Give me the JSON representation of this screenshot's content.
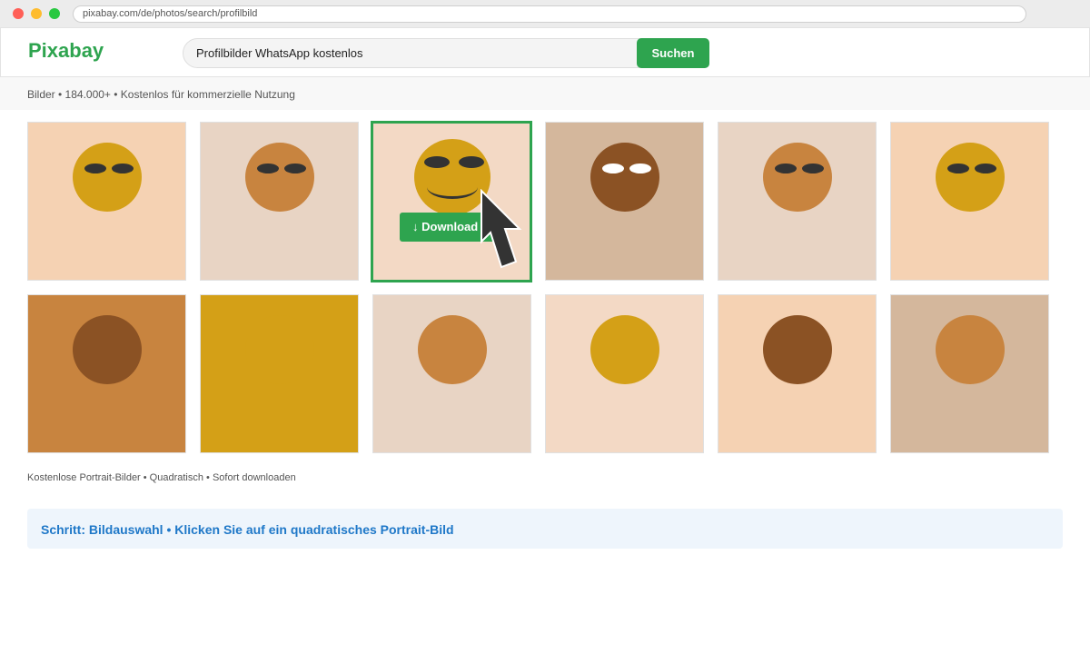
{
  "browser": {
    "url": "pixabay.com/de/photos/search/profilbild"
  },
  "header": {
    "logo": "Pixabay",
    "search_value": "Profilbilder WhatsApp kostenlos",
    "search_button": "Suchen"
  },
  "subbar": {
    "text": "Bilder • 184.000+ • Kostenlos für kommerzielle Nutzung"
  },
  "grid": {
    "row1": [
      {
        "bg": "#f5d2b3",
        "face": "#d4a017",
        "eyes": "dark"
      },
      {
        "bg": "#e8d4c4",
        "face": "#c8843f",
        "eyes": "dark"
      },
      {
        "bg": "#f3d9c5",
        "face": "#d4a017",
        "eyes": "dark",
        "selected": true
      },
      {
        "bg": "#d4b79c",
        "face": "#8b5224",
        "eyes": "white"
      },
      {
        "bg": "#e8d4c4",
        "face": "#c8843f",
        "eyes": "dark"
      },
      {
        "bg": "#f5d2b3",
        "face": "#d4a017",
        "eyes": "dark"
      }
    ],
    "row2": [
      {
        "bg": "#c8843f",
        "face": "#8b5224"
      },
      {
        "bg": "#d4a017",
        "face": "#d4a017"
      },
      {
        "bg": "#e8d4c4",
        "face": "#c8843f"
      },
      {
        "bg": "#f3d9c5",
        "face": "#d4a017"
      },
      {
        "bg": "#f5d2b3",
        "face": "#8b5224"
      },
      {
        "bg": "#d4b79c",
        "face": "#c8843f"
      }
    ]
  },
  "download_button": "↓ Download",
  "caption": "Kostenlose Portrait-Bilder • Quadratisch • Sofort downloaden",
  "step_banner": "Schritt: Bildauswahl • Klicken Sie auf ein quadratisches Portrait-Bild",
  "colors": {
    "accent": "#2ea44f",
    "step_text": "#1f78c8"
  }
}
